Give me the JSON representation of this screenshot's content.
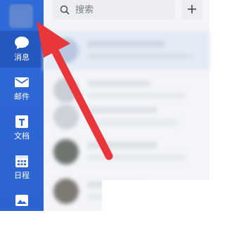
{
  "sidebar": {
    "items": [
      {
        "label": "消息",
        "icon": "chat-bubble-icon",
        "active": true
      },
      {
        "label": "邮件",
        "icon": "mail-icon",
        "active": false
      },
      {
        "label": "文档",
        "icon": "document-icon",
        "active": false
      },
      {
        "label": "日程",
        "icon": "calendar-icon",
        "active": false
      },
      {
        "label": "",
        "icon": "mountain-image-icon",
        "active": false
      }
    ]
  },
  "search": {
    "placeholder": "搜索"
  },
  "header": {
    "add_button_icon": "plus-icon"
  },
  "colors": {
    "sidebar_bg": "#2b63cf",
    "active_item_bg": "#2458be",
    "annotation_arrow": "#e8363b"
  }
}
